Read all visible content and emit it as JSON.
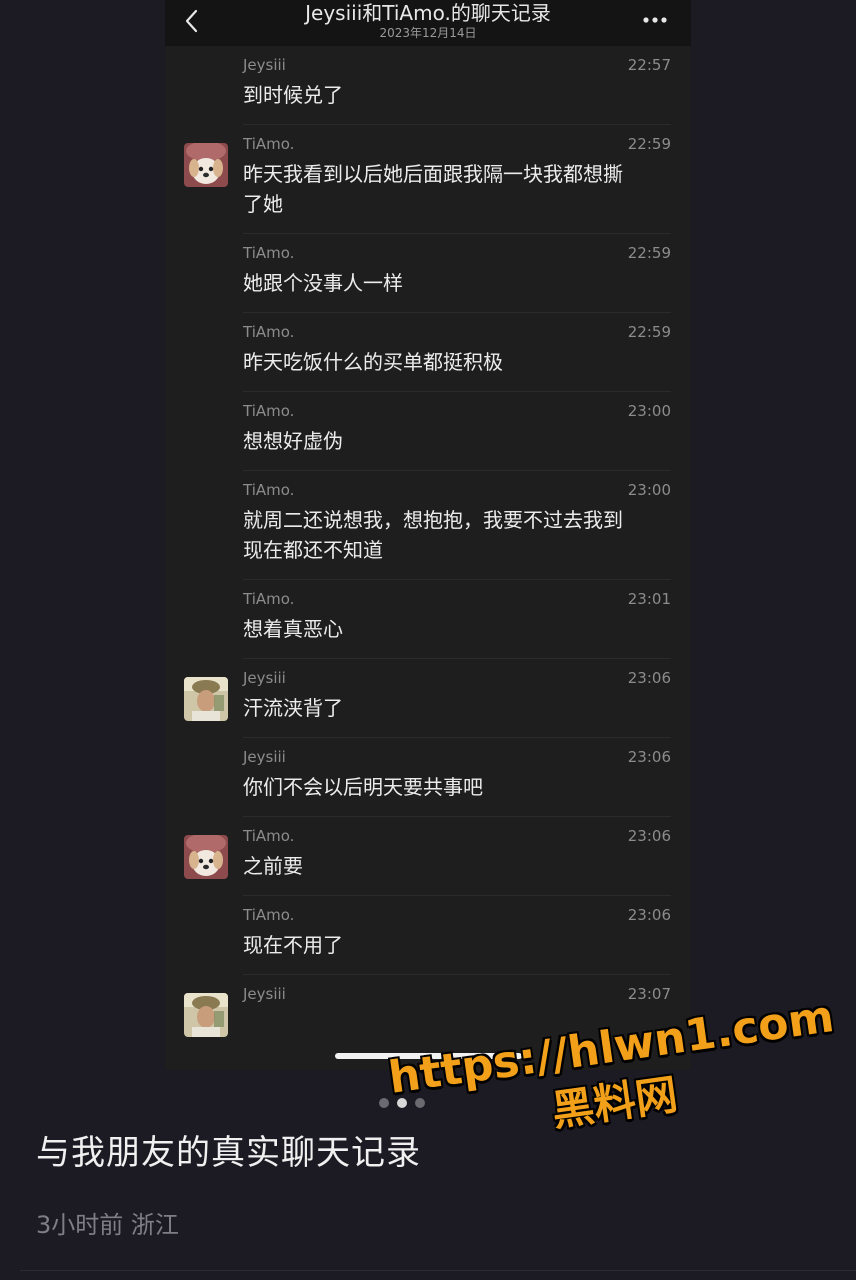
{
  "chat": {
    "title": "Jeysiii和TiAmo.的聊天记录",
    "date": "2023年12月14日",
    "messages": [
      {
        "sender": "Jeysiii",
        "time": "22:57",
        "text": "到时候兑了",
        "avatar": "",
        "lines": 1
      },
      {
        "sender": "TiAmo.",
        "time": "22:59",
        "text": "昨天我看到以后她后面跟我隔一块我都想撕\n了她",
        "avatar": "puppy-avatar",
        "lines": 2
      },
      {
        "sender": "TiAmo.",
        "time": "22:59",
        "text": "她跟个没事人一样",
        "avatar": "",
        "lines": 1
      },
      {
        "sender": "TiAmo.",
        "time": "22:59",
        "text": "昨天吃饭什么的买单都挺积极",
        "avatar": "",
        "lines": 1
      },
      {
        "sender": "TiAmo.",
        "time": "23:00",
        "text": "想想好虚伪",
        "avatar": "",
        "lines": 1
      },
      {
        "sender": "TiAmo.",
        "time": "23:00",
        "text": "就周二还说想我，想抱抱，我要不过去我到\n现在都还不知道",
        "avatar": "",
        "lines": 2
      },
      {
        "sender": "TiAmo.",
        "time": "23:01",
        "text": "想着真恶心",
        "avatar": "",
        "lines": 1
      },
      {
        "sender": "Jeysiii",
        "time": "23:06",
        "text": "汗流浃背了",
        "avatar": "person-avatar",
        "lines": 1
      },
      {
        "sender": "Jeysiii",
        "time": "23:06",
        "text": "你们不会以后明天要共事吧",
        "avatar": "",
        "lines": 1
      },
      {
        "sender": "TiAmo.",
        "time": "23:06",
        "text": "之前要",
        "avatar": "puppy-avatar",
        "lines": 1
      },
      {
        "sender": "TiAmo.",
        "time": "23:06",
        "text": "现在不用了",
        "avatar": "",
        "lines": 1
      },
      {
        "sender": "Jeysiii",
        "time": "23:07",
        "text": "",
        "avatar": "person-avatar",
        "lines": 0
      }
    ]
  },
  "post": {
    "title": "与我朋友的真实聊天记录",
    "meta": "3小时前 浙江",
    "image_count": 3,
    "active_image": 1
  },
  "watermark": {
    "url": "https://hlwn1.com",
    "name": "黑料网"
  },
  "icons": {
    "back": "chevron-left-icon",
    "more": "more-dots-icon"
  },
  "colors": {
    "background": "#1c1b23",
    "chat_background": "#1e1e1e",
    "watermark": "#f2a019"
  }
}
